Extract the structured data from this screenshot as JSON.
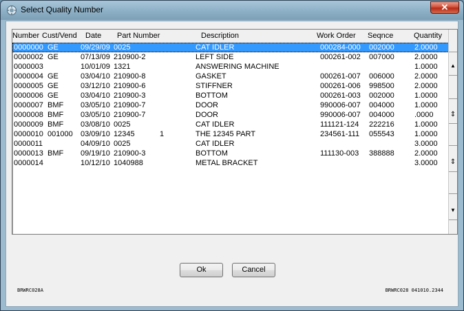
{
  "window": {
    "title": "Select Quality Number",
    "close_label": "✕"
  },
  "grid": {
    "headers": {
      "number": "Number",
      "cust_vend": "Cust/Vend",
      "date": "Date",
      "part_number": "Part Number",
      "description": "Description",
      "work_order": "Work Order",
      "seqnce": "Seqnce",
      "quantity": "Quantity"
    },
    "rows": [
      {
        "number": "0000000",
        "cust_vend": "GE",
        "date": "09/29/09",
        "part": "0025",
        "extra": "",
        "description": "CAT IDLER",
        "work_order": "000284-000",
        "seqnce": "002000",
        "quantity": "2.0000"
      },
      {
        "number": "0000002",
        "cust_vend": "GE",
        "date": "07/13/09",
        "part": "210900-2",
        "extra": "",
        "description": "LEFT SIDE",
        "work_order": "000261-002",
        "seqnce": "007000",
        "quantity": "2.0000"
      },
      {
        "number": "0000003",
        "cust_vend": "",
        "date": "10/01/09",
        "part": "1321",
        "extra": "",
        "description": "ANSWERING MACHINE",
        "work_order": "",
        "seqnce": "",
        "quantity": "1.0000"
      },
      {
        "number": "0000004",
        "cust_vend": "GE",
        "date": "03/04/10",
        "part": "210900-8",
        "extra": "",
        "description": "GASKET",
        "work_order": "000261-007",
        "seqnce": "006000",
        "quantity": "2.0000"
      },
      {
        "number": "0000005",
        "cust_vend": "GE",
        "date": "03/12/10",
        "part": "210900-6",
        "extra": "",
        "description": "STIFFNER",
        "work_order": "000261-006",
        "seqnce": "998500",
        "quantity": "2.0000"
      },
      {
        "number": "0000006",
        "cust_vend": "GE",
        "date": "03/04/10",
        "part": "210900-3",
        "extra": "",
        "description": "BOTTOM",
        "work_order": "000261-003",
        "seqnce": "002000",
        "quantity": "1.0000"
      },
      {
        "number": "0000007",
        "cust_vend": "BMF",
        "date": "03/05/10",
        "part": "210900-7",
        "extra": "",
        "description": "DOOR",
        "work_order": "990006-007",
        "seqnce": "004000",
        "quantity": "1.0000"
      },
      {
        "number": "0000008",
        "cust_vend": "BMF",
        "date": "03/05/10",
        "part": "210900-7",
        "extra": "",
        "description": "DOOR",
        "work_order": "990006-007",
        "seqnce": "004000",
        "quantity": ".0000"
      },
      {
        "number": "0000009",
        "cust_vend": "BMF",
        "date": "03/08/10",
        "part": "0025",
        "extra": "",
        "description": "CAT IDLER",
        "work_order": "111121-124",
        "seqnce": "222216",
        "quantity": "1.0000"
      },
      {
        "number": "0000010",
        "cust_vend": "001000",
        "date": "03/09/10",
        "part": "12345",
        "extra": "1",
        "description": "THE 12345 PART",
        "work_order": "234561-111",
        "seqnce": "055543",
        "quantity": "1.0000"
      },
      {
        "number": "0000011",
        "cust_vend": "",
        "date": "04/09/10",
        "part": "0025",
        "extra": "",
        "description": "CAT IDLER",
        "work_order": "",
        "seqnce": "",
        "quantity": "3.0000"
      },
      {
        "number": "0000013",
        "cust_vend": "BMF",
        "date": "09/19/10",
        "part": "210900-3",
        "extra": "",
        "description": "BOTTOM",
        "work_order": "111130-003",
        "seqnce": "388888",
        "quantity": "2.0000"
      },
      {
        "number": "0000014",
        "cust_vend": "",
        "date": "10/12/10",
        "part": "1040988",
        "extra": "",
        "description": "METAL BRACKET",
        "work_order": "",
        "seqnce": "",
        "quantity": "3.0000"
      }
    ],
    "scroll": {
      "up": "▲",
      "updown": "⇕",
      "down_double": "⇕",
      "down": "▼"
    }
  },
  "buttons": {
    "ok": "Ok",
    "cancel": "Cancel"
  },
  "footer": {
    "left": "BRWRC028A",
    "right": "BRWRC028 041010.2344"
  }
}
